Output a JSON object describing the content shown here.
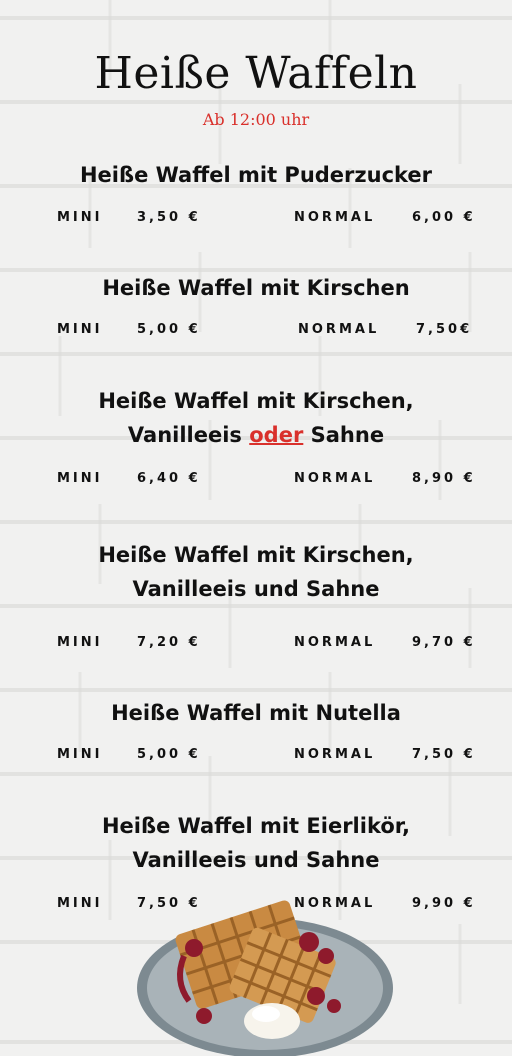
{
  "header": {
    "title": "Heiße Waffeln",
    "subtitle": "Ab 12:00 uhr"
  },
  "labels": {
    "mini": "MINI",
    "normal": "NORMAL"
  },
  "items": [
    {
      "name": "Heiße Waffel mit Puderzucker",
      "mini": "3,50 €",
      "normal": "6,00 €"
    },
    {
      "name": "Heiße Waffel mit Kirschen",
      "mini": "5,00 €",
      "normal": "7,50€"
    },
    {
      "name_line1": "Heiße Waffel mit Kirschen,",
      "name_line2_pre": "Vanilleeis ",
      "name_line2_oder": "oder",
      "name_line2_post": " Sahne",
      "mini": "6,40 €",
      "normal": "8,90 €"
    },
    {
      "name_line1": "Heiße Waffel mit Kirschen,",
      "name_line2": "Vanilleeis und Sahne",
      "mini": "7,20 €",
      "normal": "9,70 €"
    },
    {
      "name": "Heiße Waffel mit Nutella",
      "mini": "5,00 €",
      "normal": "7,50 €"
    },
    {
      "name_line1": "Heiße Waffel mit Eierlikör,",
      "name_line2": "Vanilleeis und Sahne",
      "mini": "7,50 €",
      "normal": "9,90 €"
    }
  ],
  "colors": {
    "accent": "#d9302b",
    "text": "#111111",
    "background": "#f1f1f0"
  },
  "image": {
    "icon": "waffle-plate-icon"
  }
}
